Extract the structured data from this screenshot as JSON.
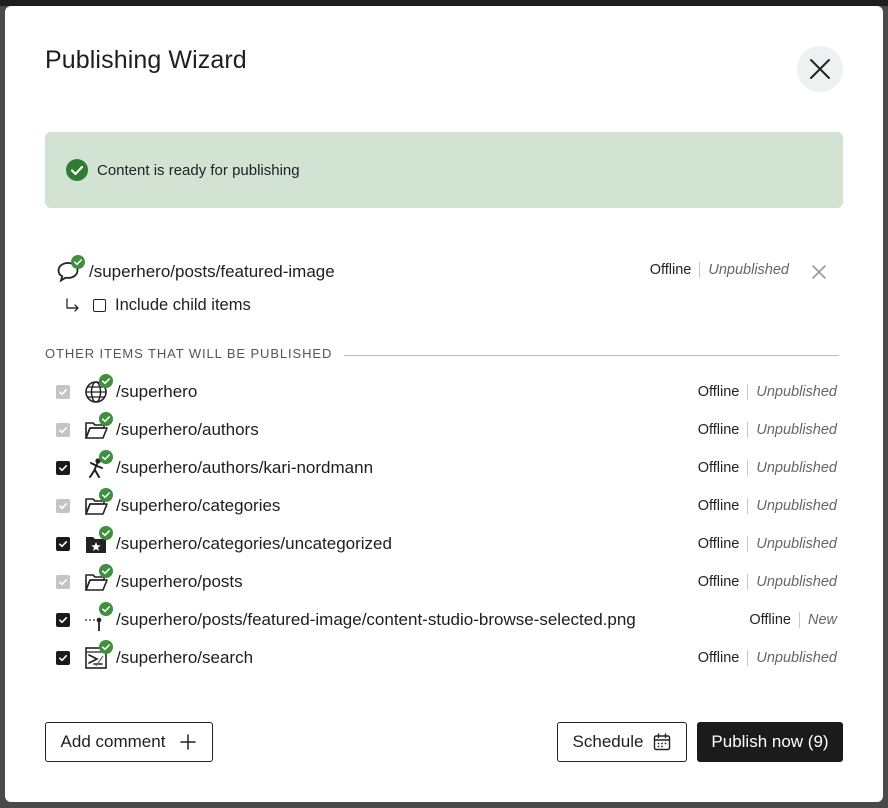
{
  "dialog": {
    "title": "Publishing Wizard",
    "close_icon": "close-icon"
  },
  "banner": {
    "icon": "check-circle-icon",
    "message": "Content is ready for publishing",
    "bg_color": "#d2e2d3",
    "icon_color": "#2e7d32"
  },
  "main_item": {
    "icon": "comment-icon",
    "path": "/superhero/posts/featured-image",
    "online_status": "Offline",
    "publish_status": "Unpublished",
    "include_children_label": "Include child items",
    "include_children_checked": false
  },
  "dependencies": {
    "heading": "OTHER ITEMS THAT WILL BE PUBLISHED",
    "items": [
      {
        "path": "/superhero",
        "icon": "globe-icon",
        "checked": true,
        "disabled": true,
        "online_status": "Offline",
        "publish_status": "Unpublished"
      },
      {
        "path": "/superhero/authors",
        "icon": "folder-icon",
        "checked": true,
        "disabled": true,
        "online_status": "Offline",
        "publish_status": "Unpublished"
      },
      {
        "path": "/superhero/authors/kari-nordmann",
        "icon": "person-icon",
        "checked": true,
        "disabled": false,
        "online_status": "Offline",
        "publish_status": "Unpublished"
      },
      {
        "path": "/superhero/categories",
        "icon": "folder-icon",
        "checked": true,
        "disabled": true,
        "online_status": "Offline",
        "publish_status": "Unpublished"
      },
      {
        "path": "/superhero/categories/uncategorized",
        "icon": "star-folder-icon",
        "checked": true,
        "disabled": false,
        "online_status": "Offline",
        "publish_status": "Unpublished"
      },
      {
        "path": "/superhero/posts",
        "icon": "folder-icon",
        "checked": true,
        "disabled": true,
        "online_status": "Offline",
        "publish_status": "Unpublished"
      },
      {
        "path": "/superhero/posts/featured-image/content-studio-browse-selected.png",
        "icon": "image-icon",
        "checked": true,
        "disabled": false,
        "online_status": "Offline",
        "publish_status": "New"
      },
      {
        "path": "/superhero/search",
        "icon": "search-page-icon",
        "checked": true,
        "disabled": false,
        "online_status": "Offline",
        "publish_status": "Unpublished"
      }
    ]
  },
  "footer": {
    "add_comment_label": "Add comment",
    "schedule_label": "Schedule",
    "publish_label": "Publish now (9)"
  },
  "colors": {
    "valid_badge": "#3f8f3f",
    "primary_button": "#1b1b1b"
  }
}
